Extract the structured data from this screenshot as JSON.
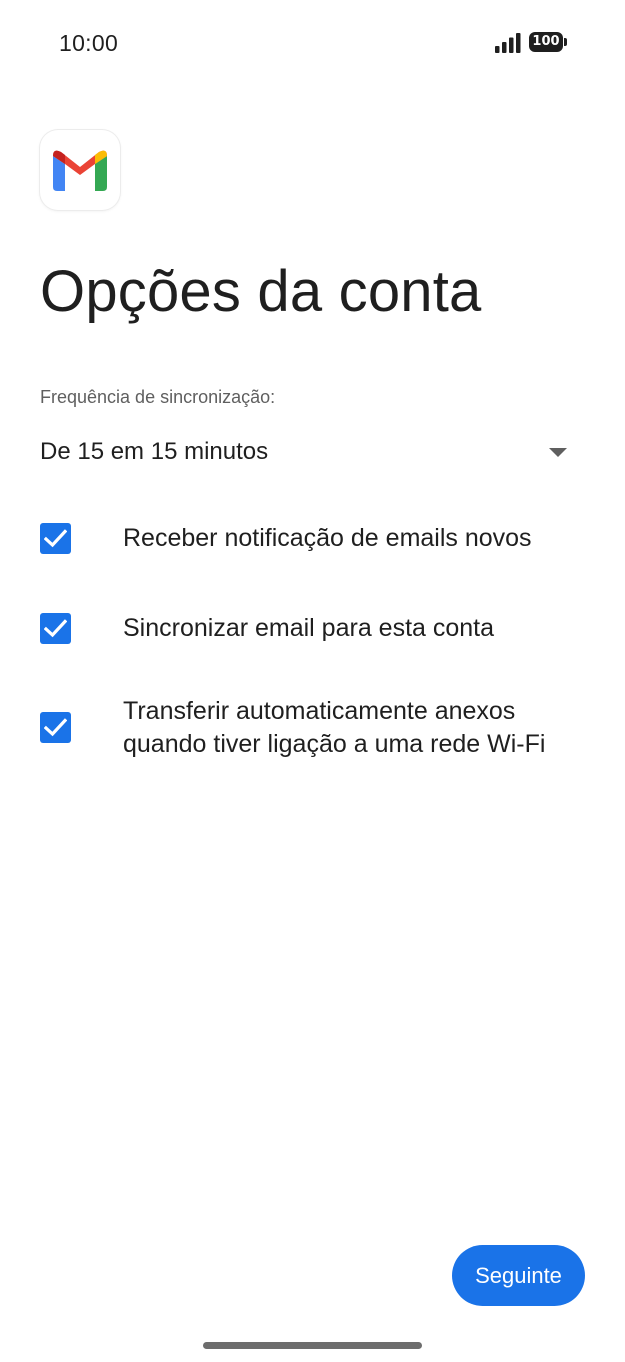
{
  "status_bar": {
    "time": "10:00",
    "battery": "100",
    "icons": [
      "signal-icon",
      "battery-icon"
    ]
  },
  "app": {
    "logo": "gmail-logo-icon",
    "brand_colors": {
      "blue": "#4285F4",
      "red": "#EA4335",
      "yellow": "#FBBC04",
      "green": "#34A853"
    }
  },
  "page": {
    "title": "Opções da conta"
  },
  "sync": {
    "label": "Frequência de sincronização:",
    "value": "De 15 em 15 minutos"
  },
  "options": [
    {
      "label": "Receber notificação de emails novos",
      "checked": true
    },
    {
      "label": "Sincronizar email para esta conta",
      "checked": true
    },
    {
      "label_line1": "Transferir automaticamente anexos",
      "label_line2": "quando tiver ligação a uma rede Wi-Fi",
      "checked": true
    }
  ],
  "actions": {
    "next_label": "Seguinte"
  },
  "colors": {
    "accent": "#1A73E8",
    "text": "#1F1F1F",
    "secondary_text": "#5F5F5F"
  }
}
